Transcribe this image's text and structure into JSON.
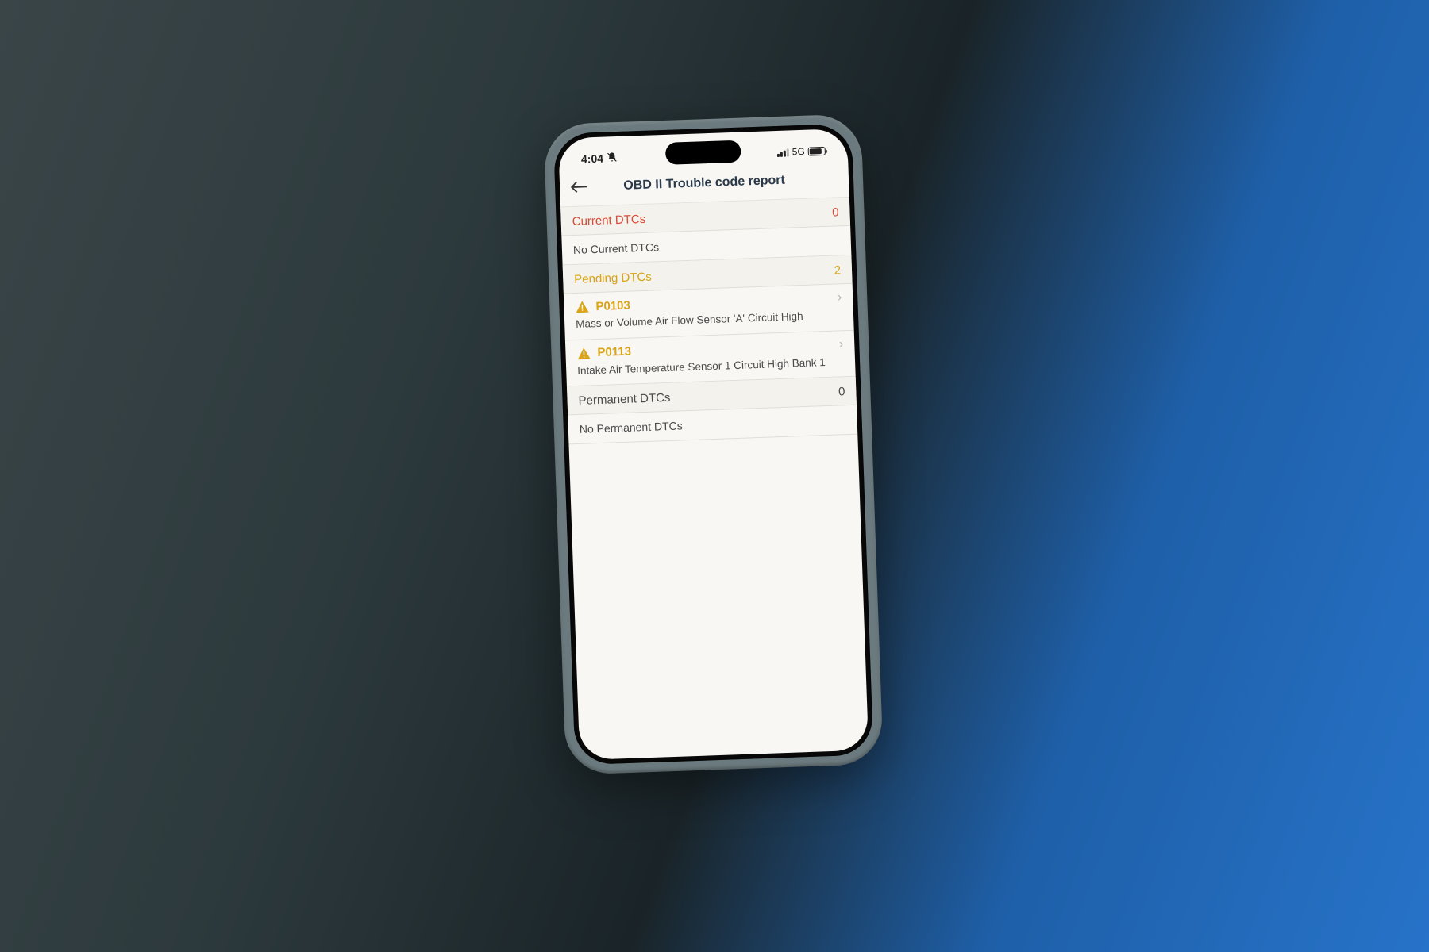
{
  "status_bar": {
    "time": "4:04",
    "network_label": "5G"
  },
  "nav": {
    "title": "OBD II Trouble code report"
  },
  "sections": {
    "current": {
      "title": "Current DTCs",
      "count": "0",
      "empty_text": "No Current DTCs"
    },
    "pending": {
      "title": "Pending DTCs",
      "count": "2",
      "items": [
        {
          "code": "P0103",
          "desc": "Mass or Volume Air Flow Sensor 'A' Circuit High"
        },
        {
          "code": "P0113",
          "desc": "Intake Air Temperature Sensor 1 Circuit High Bank 1"
        }
      ]
    },
    "permanent": {
      "title": "Permanent DTCs",
      "count": "0",
      "empty_text": "No Permanent DTCs"
    }
  }
}
